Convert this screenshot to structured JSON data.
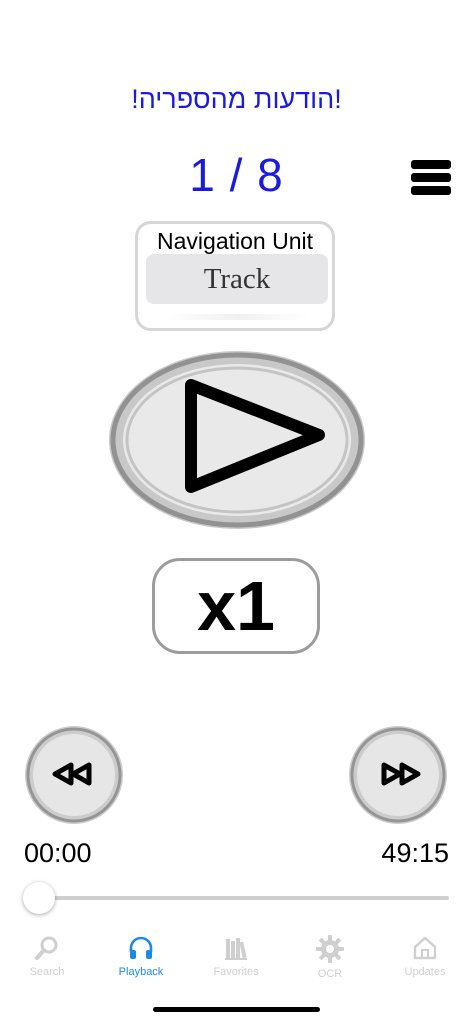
{
  "header": {
    "title": "!הודעות מהספריה!",
    "counter": "1 / 8"
  },
  "navigation_unit": {
    "label": "Navigation Unit",
    "value": "Track"
  },
  "player": {
    "speed": "x1",
    "current_time": "00:00",
    "total_time": "49:15",
    "progress": 0
  },
  "tabs": [
    {
      "label": "Search",
      "icon": "search-icon",
      "active": false
    },
    {
      "label": "Playback",
      "icon": "headphones-icon",
      "active": true
    },
    {
      "label": "Favorites",
      "icon": "books-icon",
      "active": false
    },
    {
      "label": "OCR",
      "icon": "gear-icon",
      "active": false
    },
    {
      "label": "Updates",
      "icon": "home-icon",
      "active": false
    }
  ],
  "colors": {
    "accent": "#1a1ae0",
    "tab_active": "#1e88e5",
    "tab_inactive": "#cfcfcf"
  }
}
